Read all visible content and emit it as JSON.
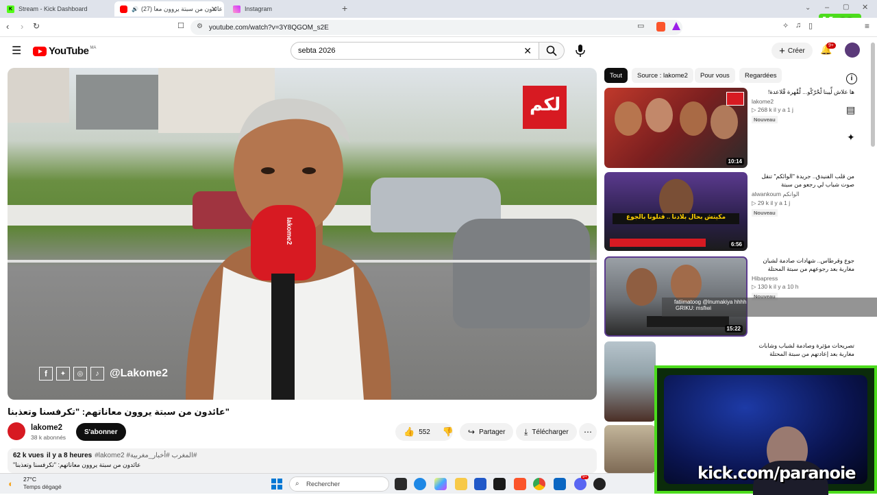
{
  "browser": {
    "tabs": [
      {
        "title": "Stream - Kick Dashboard",
        "icon": "kick-icon",
        "active": false
      },
      {
        "title": "(27) عائدون من سبتة يروون معا",
        "icon": "youtube-icon",
        "active": true
      },
      {
        "title": "Instagram",
        "icon": "instagram-icon",
        "active": false
      }
    ],
    "url": "youtube.com/watch?v=3Y8QGOM_s2E",
    "kick_counter": "82"
  },
  "youtube": {
    "logo": "YouTube",
    "country_code": "MA",
    "search_value": "sebta 2026",
    "create_label": "Créer",
    "notif_badge": "9+"
  },
  "video": {
    "title": "\"عائدون من سبتة يروون معاناتهم: \"تكرفسنا وتعذبنا",
    "handle_overlay": "@Lakome2",
    "channel_name": "lakome2",
    "subscribers": "38 k abonnés",
    "subscribe_label": "S'abonner",
    "likes": "552",
    "share_label": "Partager",
    "download_label": "Télécharger",
    "views": "62 k vues",
    "age": "il y a 8 heures",
    "hashtags": "#lakome2 #المغرب #أخبار_مغربية#",
    "desc_line": "عائدون من سبتة يروون معاناتهم: \"تكرفسنا وتعذبنا\""
  },
  "chips": [
    "Tout",
    "Source : lakome2",
    "Pour vous",
    "Regardées"
  ],
  "recommendations": [
    {
      "title": "ها علاش لِّيبنا لْحْرّكْو... لْقْهرة قْلاعدة!",
      "channel": "lakome2",
      "stats": "268 k  il y a 1 j",
      "badge": "Nouveau",
      "duration": "10:14"
    },
    {
      "title": "من قلب الفنيدق.. جريدة \"الوائكم\" تنقل صوت شباب لي رجعو من سبتة",
      "channel": "alwankoum الوانكم",
      "stats": "29 k  il y a 1 j",
      "badge": "Nouveau",
      "duration": "6:56"
    },
    {
      "title": "جوع وقرطاس.. شهادات صادمة لشبان مغاربة بعد رجوعهم من سبتة المحتلة",
      "channel": "Hibapress",
      "stats": "130 k  il y a 10 h",
      "badge": "Nouveau",
      "duration": "15:22"
    },
    {
      "title": "تصريحات مؤثرة وصادمة لشباب وشابات مغاربة بعد إعادتهم من سبتة المحتلة",
      "channel": "",
      "stats": "",
      "badge": "",
      "duration": ""
    }
  ],
  "chat_overlay": {
    "line1": "fatiimatoog @lnumakiya hhhh",
    "line2": "GRIKU: msfiwi"
  },
  "stream": {
    "kick_url": "kick.com/paranoie"
  },
  "taskbar": {
    "temperature": "27°C",
    "weather": "Temps dégagé",
    "search_placeholder": "Rechercher",
    "notif_count": "9+"
  }
}
